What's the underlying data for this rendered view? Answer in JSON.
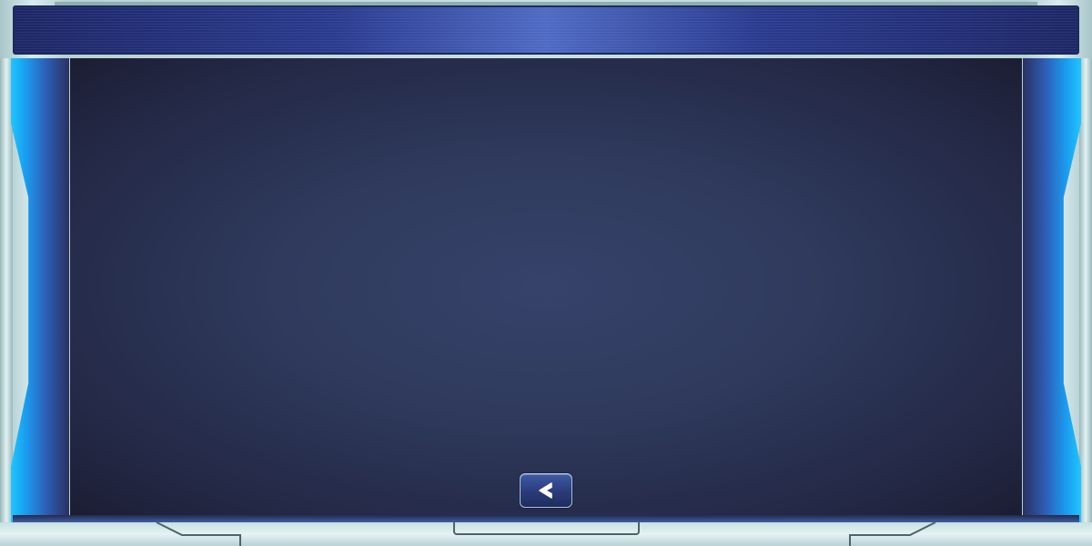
{
  "screen": {
    "name": "empty-dialog-panel"
  },
  "controls": {
    "back_button": {
      "icon": "chevron-left-icon"
    }
  },
  "colors": {
    "panel_center": "#36426a",
    "panel_edge": "#1b1d33",
    "header_blue": "#2a3a8e",
    "glow_cyan": "#1ec6ff",
    "metal": "#c9e0e2"
  }
}
